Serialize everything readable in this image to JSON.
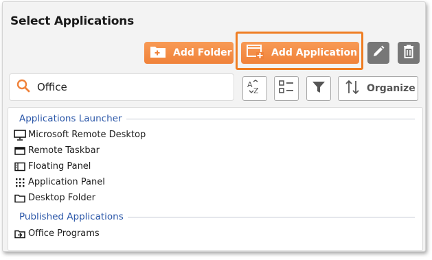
{
  "panel": {
    "title": "Select Applications"
  },
  "toolbar": {
    "add_folder_label": "Add Folder",
    "add_application_label": "Add Application",
    "edit_icon": "pencil-icon",
    "delete_icon": "trash-icon"
  },
  "search": {
    "value": "Office",
    "icon": "search-icon"
  },
  "tools": {
    "sort_icon": "sort-az-icon",
    "view_icon": "list-view-icon",
    "filter_icon": "filter-icon",
    "organize_label": "Organize",
    "organize_icon": "sort-arrows-icon"
  },
  "groups": [
    {
      "label": "Applications Launcher",
      "items": [
        {
          "label": "Microsoft Remote Desktop",
          "icon": "monitor-icon"
        },
        {
          "label": "Remote Taskbar",
          "icon": "taskbar-window-icon"
        },
        {
          "label": "Floating Panel",
          "icon": "floating-panel-icon"
        },
        {
          "label": "Application Panel",
          "icon": "grid-dots-icon"
        },
        {
          "label": "Desktop Folder",
          "icon": "folder-icon"
        }
      ]
    },
    {
      "label": "Published Applications",
      "items": [
        {
          "label": "Office Programs",
          "icon": "folder-publish-icon"
        }
      ]
    }
  ],
  "colors": {
    "accent_orange": "#f0823a",
    "highlight_border": "#ef7d22",
    "group_label": "#2a56a8",
    "gray_button": "#777777"
  }
}
